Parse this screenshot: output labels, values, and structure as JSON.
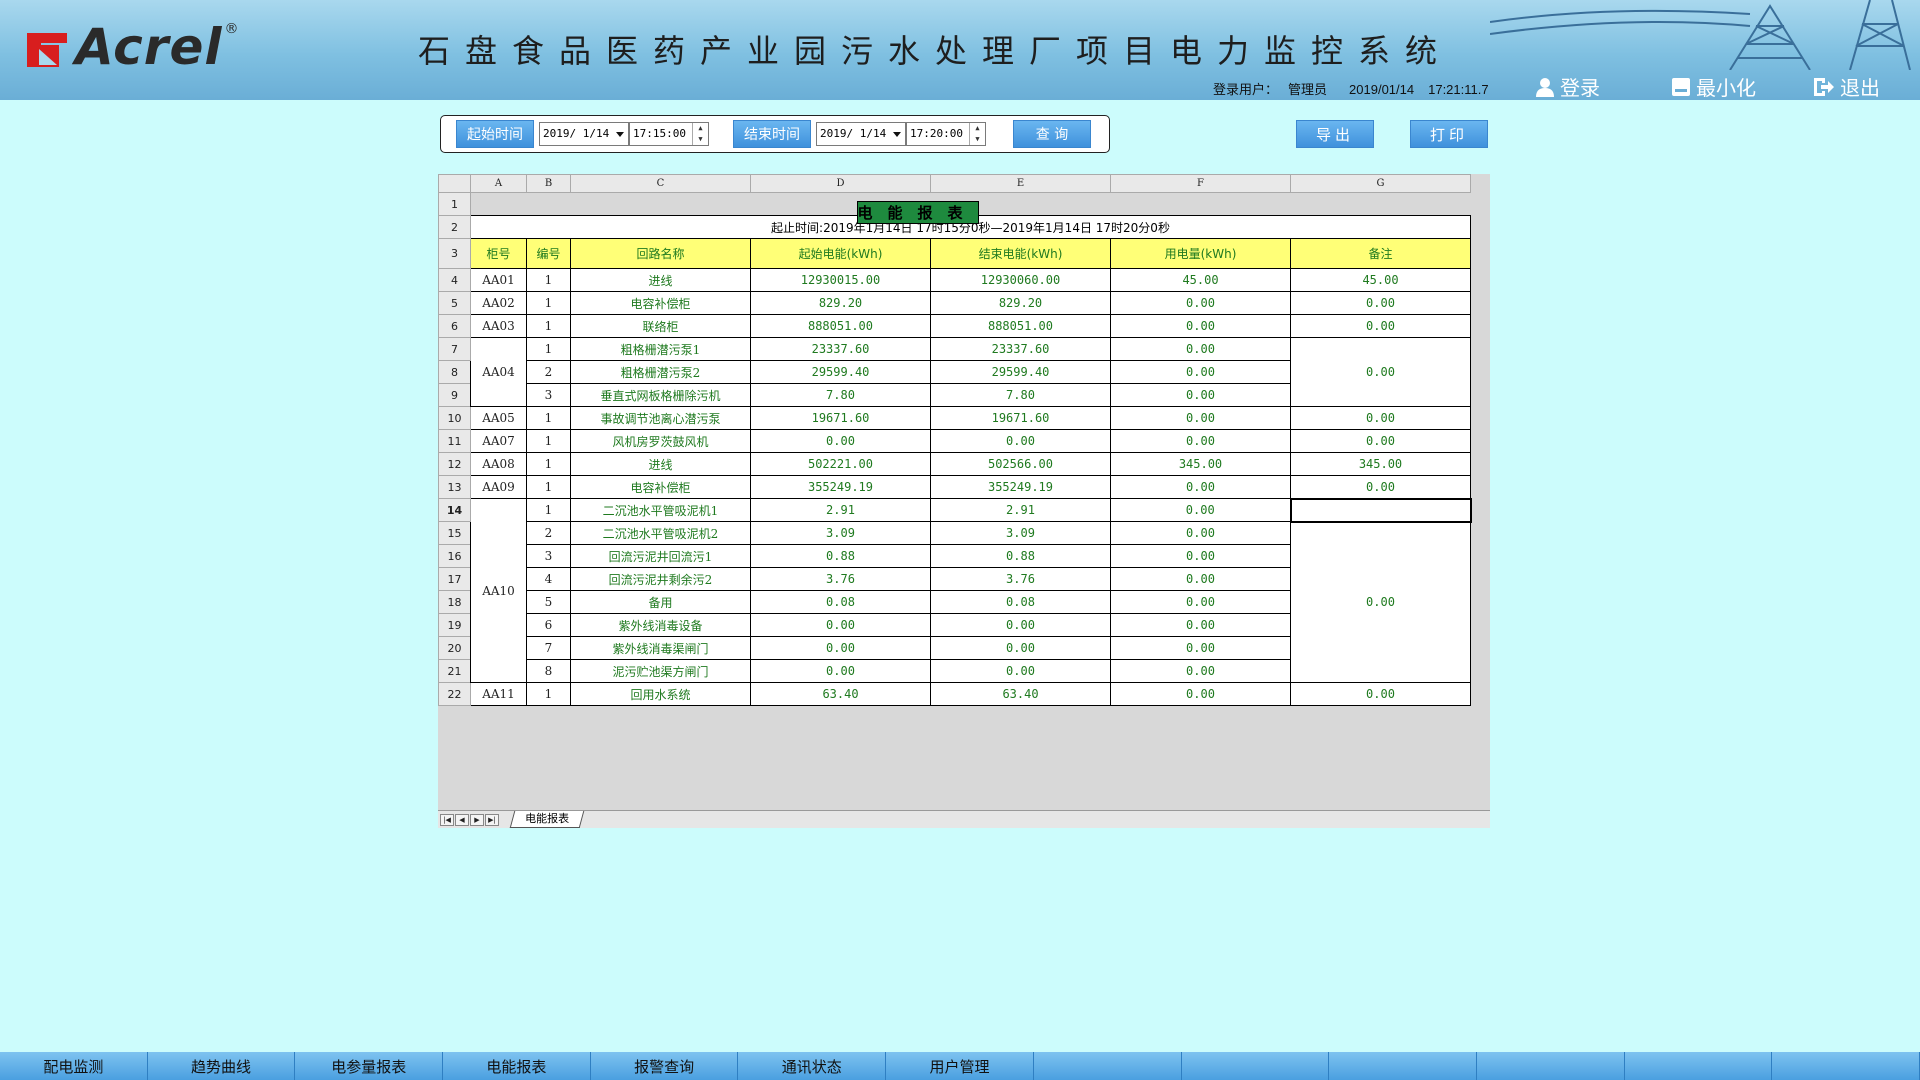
{
  "header": {
    "logo_text": "Acrel",
    "logo_reg": "®",
    "title": "石盘食品医药产业园污水处理厂项目电力监控系统",
    "user_label": "登录用户：",
    "user_name": "管理员",
    "date": "2019/01/14",
    "time": "17:21:11.7",
    "login_label": "登录",
    "minimize_label": "最小化",
    "exit_label": "退出"
  },
  "filter": {
    "start_label": "起始时间",
    "start_date": "2019/ 1/14",
    "start_time": "17:15:00",
    "end_label": "结束时间",
    "end_date": "2019/ 1/14",
    "end_time": "17:20:00",
    "query_label": "查 询"
  },
  "toolbar": {
    "export_label": "导出",
    "print_label": "打印"
  },
  "sheet": {
    "col_letters": [
      "A",
      "B",
      "C",
      "D",
      "E",
      "F",
      "G"
    ],
    "title": "电能报表",
    "subtitle": "起止时间:2019年1月14日  17时15分0秒—2019年1月14日  17时20分0秒",
    "headers": [
      "柜号",
      "编号",
      "回路名称",
      "起始电能(kWh)",
      "结束电能(kWh)",
      "用电量(kWh)",
      "备注"
    ],
    "row_numbers": [
      "1",
      "2",
      "3",
      "4",
      "5",
      "6",
      "7",
      "8",
      "9",
      "10",
      "11",
      "12",
      "13",
      "14",
      "15",
      "16",
      "17",
      "18",
      "19",
      "20",
      "21",
      "22"
    ],
    "rows": [
      {
        "cab": "AA01",
        "no": "1",
        "name": "进线",
        "start": "12930015.00",
        "end": "12930060.00",
        "use": "45.00",
        "note": "45.00"
      },
      {
        "cab": "AA02",
        "no": "1",
        "name": "电容补偿柜",
        "start": "829.20",
        "end": "829.20",
        "use": "0.00",
        "note": "0.00"
      },
      {
        "cab": "AA03",
        "no": "1",
        "name": "联络柜",
        "start": "888051.00",
        "end": "888051.00",
        "use": "0.00",
        "note": "0.00"
      },
      {
        "cab": "AA04",
        "no": "1",
        "name": "粗格栅潜污泵1",
        "start": "23337.60",
        "end": "23337.60",
        "use": "0.00",
        "note": "0.00"
      },
      {
        "cab": "",
        "no": "2",
        "name": "粗格栅潜污泵2",
        "start": "29599.40",
        "end": "29599.40",
        "use": "0.00",
        "note": ""
      },
      {
        "cab": "",
        "no": "3",
        "name": "垂直式网板格栅除污机",
        "start": "7.80",
        "end": "7.80",
        "use": "0.00",
        "note": ""
      },
      {
        "cab": "AA05",
        "no": "1",
        "name": "事故调节池离心潜污泵",
        "start": "19671.60",
        "end": "19671.60",
        "use": "0.00",
        "note": "0.00"
      },
      {
        "cab": "AA07",
        "no": "1",
        "name": "风机房罗茨鼓风机",
        "start": "0.00",
        "end": "0.00",
        "use": "0.00",
        "note": "0.00"
      },
      {
        "cab": "AA08",
        "no": "1",
        "name": "进线",
        "start": "502221.00",
        "end": "502566.00",
        "use": "345.00",
        "note": "345.00"
      },
      {
        "cab": "AA09",
        "no": "1",
        "name": "电容补偿柜",
        "start": "355249.19",
        "end": "355249.19",
        "use": "0.00",
        "note": "0.00"
      },
      {
        "cab": "AA10",
        "no": "1",
        "name": "二沉池水平管吸泥机1",
        "start": "2.91",
        "end": "2.91",
        "use": "0.00",
        "note": ""
      },
      {
        "cab": "",
        "no": "2",
        "name": "二沉池水平管吸泥机2",
        "start": "3.09",
        "end": "3.09",
        "use": "0.00",
        "note": "0.00"
      },
      {
        "cab": "",
        "no": "3",
        "name": "回流污泥井回流污1",
        "start": "0.88",
        "end": "0.88",
        "use": "0.00",
        "note": ""
      },
      {
        "cab": "",
        "no": "4",
        "name": "回流污泥井剩余污2",
        "start": "3.76",
        "end": "3.76",
        "use": "0.00",
        "note": ""
      },
      {
        "cab": "",
        "no": "5",
        "name": "备用",
        "start": "0.08",
        "end": "0.08",
        "use": "0.00",
        "note": ""
      },
      {
        "cab": "",
        "no": "6",
        "name": "紫外线消毒设备",
        "start": "0.00",
        "end": "0.00",
        "use": "0.00",
        "note": ""
      },
      {
        "cab": "",
        "no": "7",
        "name": "紫外线消毒渠闸门",
        "start": "0.00",
        "end": "0.00",
        "use": "0.00",
        "note": ""
      },
      {
        "cab": "",
        "no": "8",
        "name": "泥污贮池渠方闸门",
        "start": "0.00",
        "end": "0.00",
        "use": "0.00",
        "note": ""
      },
      {
        "cab": "AA11",
        "no": "1",
        "name": "回用水系统",
        "start": "63.40",
        "end": "63.40",
        "use": "0.00",
        "note": "0.00"
      }
    ],
    "tab_name": "电能报表",
    "tab_nav": [
      "|◀",
      "◀",
      "▶",
      "▶|"
    ]
  },
  "nav": {
    "items": [
      "配电监测",
      "趋势曲线",
      "电参量报表",
      "电能报表",
      "报警查询",
      "通讯状态",
      "用户管理",
      "",
      "",
      "",
      "",
      "",
      ""
    ]
  },
  "colors": {
    "accent": "#3f91dc",
    "header_green": "#1e8a3e",
    "header_yellow": "#ffff77",
    "bg": "#ccfcfc"
  }
}
